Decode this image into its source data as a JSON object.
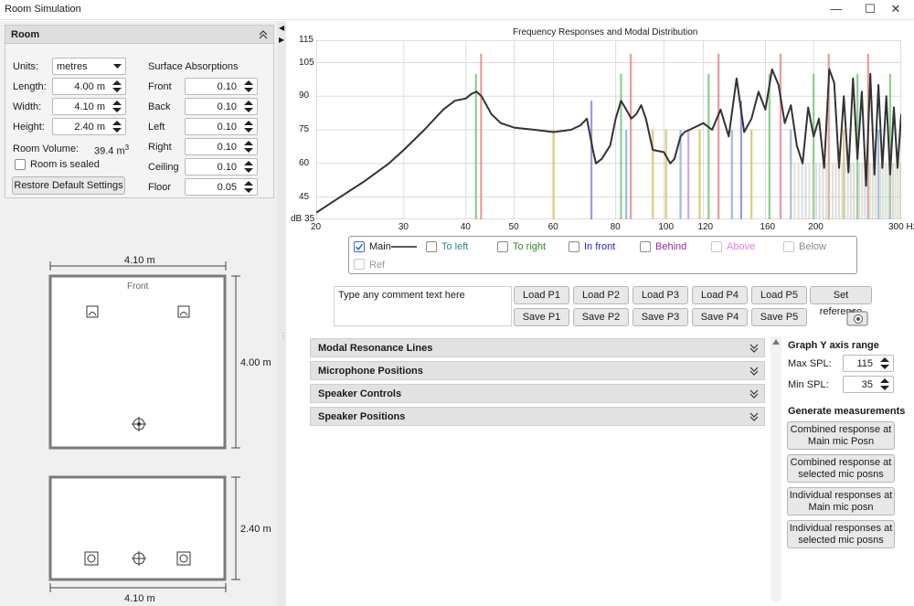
{
  "window": {
    "title": "Room Simulation",
    "minimize": "—",
    "maximize": "☐",
    "close": "✕"
  },
  "room_panel": {
    "header": "Room",
    "collapse_icon": "chevron-double-up",
    "units_label": "Units:",
    "units_value": "metres",
    "length_label": "Length:",
    "length_value": "4.00 m",
    "width_label": "Width:",
    "width_value": "4.10 m",
    "height_label": "Height:",
    "height_value": "2.40 m",
    "volume_label": "Room Volume:",
    "volume_value": "39.4 m",
    "volume_unit_sup": "3",
    "sealed_label": "Room is sealed",
    "sealed_checked": false,
    "restore_button": "Restore Default Settings",
    "absorptions_heading": "Surface Absorptions",
    "absorptions": [
      {
        "label": "Front",
        "value": "0.10"
      },
      {
        "label": "Back",
        "value": "0.10"
      },
      {
        "label": "Left",
        "value": "0.10"
      },
      {
        "label": "Right",
        "value": "0.10"
      },
      {
        "label": "Ceiling",
        "value": "0.10"
      },
      {
        "label": "Floor",
        "value": "0.05"
      }
    ]
  },
  "plan_view": {
    "width_label": "4.10 m",
    "length_label": "4.00 m",
    "front_label": "Front"
  },
  "elevation_view": {
    "height_label": "2.40 m",
    "width_label": "4.10 m"
  },
  "chart_data": {
    "type": "line",
    "title": "Frequency Responses and Modal Distribution",
    "x_scale": "log",
    "xlim": [
      20,
      300
    ],
    "x_ticks": [
      "20",
      "30",
      "40",
      "50",
      "60",
      "80",
      "100",
      "120",
      "160",
      "200",
      "300 Hz"
    ],
    "y_ticks": [
      "dB 35",
      "45",
      "60",
      "75",
      "90",
      "105",
      "115"
    ],
    "ylim": [
      35,
      115
    ],
    "grid": true,
    "series": [
      {
        "name": "Main",
        "color": "#333333",
        "x": [
          20,
          22,
          25,
          28,
          30,
          33,
          36,
          38,
          40,
          41,
          42,
          43,
          44,
          45,
          47,
          50,
          55,
          60,
          65,
          68,
          70,
          72,
          73,
          75,
          78,
          80,
          82,
          84,
          86,
          88,
          90,
          92,
          95,
          100,
          103,
          105,
          108,
          110,
          115,
          120,
          125,
          130,
          135,
          140,
          145,
          150,
          155,
          160,
          165,
          170,
          175,
          180,
          185,
          190,
          195,
          200,
          205,
          210,
          215,
          220,
          225,
          230,
          235,
          240,
          245,
          250,
          255,
          260,
          265,
          270,
          275,
          280,
          285,
          290,
          295,
          300
        ],
        "y": [
          38,
          44,
          52,
          60,
          66,
          75,
          84,
          88,
          89,
          91,
          92,
          90,
          86,
          82,
          78,
          76,
          75,
          74,
          75,
          77,
          80,
          66,
          60,
          62,
          68,
          80,
          88,
          84,
          80,
          82,
          86,
          80,
          66,
          65,
          60,
          62,
          72,
          74,
          76,
          78,
          75,
          84,
          72,
          98,
          74,
          80,
          92,
          84,
          102,
          95,
          78,
          86,
          68,
          60,
          85,
          72,
          80,
          58,
          102,
          96,
          58,
          90,
          56,
          98,
          62,
          92,
          50,
          100,
          55,
          95,
          58,
          90,
          55,
          85,
          58,
          82
        ]
      }
    ],
    "modal_lines": [
      {
        "x": 41.9,
        "y": 100,
        "color": "#7bc67b"
      },
      {
        "x": 42.9,
        "y": 109,
        "color": "#e88a8a"
      },
      {
        "x": 60.0,
        "y": 75,
        "color": "#d9c266"
      },
      {
        "x": 71.5,
        "y": 88,
        "color": "#8a8ae0"
      },
      {
        "x": 82.0,
        "y": 100,
        "color": "#7bc67b"
      },
      {
        "x": 84.0,
        "y": 75,
        "color": "#8ab0e0"
      },
      {
        "x": 85.8,
        "y": 109,
        "color": "#e88a8a"
      },
      {
        "x": 95.0,
        "y": 75,
        "color": "#d9c266"
      },
      {
        "x": 101.0,
        "y": 75,
        "color": "#d9c266"
      },
      {
        "x": 108.0,
        "y": 75,
        "color": "#8ab0e0"
      },
      {
        "x": 112.0,
        "y": 75,
        "color": "#c0a0e0"
      },
      {
        "x": 118.0,
        "y": 75,
        "color": "#d9c266"
      },
      {
        "x": 123.0,
        "y": 100,
        "color": "#7bc67b"
      },
      {
        "x": 128.8,
        "y": 109,
        "color": "#e88a8a"
      },
      {
        "x": 137.0,
        "y": 75,
        "color": "#8ab0e0"
      },
      {
        "x": 143.0,
        "y": 88,
        "color": "#8a8ae0"
      },
      {
        "x": 150.0,
        "y": 75,
        "color": "#d9c266"
      },
      {
        "x": 163.0,
        "y": 100,
        "color": "#7bc67b"
      },
      {
        "x": 171.6,
        "y": 109,
        "color": "#e88a8a"
      },
      {
        "x": 180.0,
        "y": 75,
        "color": "#8ab0e0"
      },
      {
        "x": 200.0,
        "y": 100,
        "color": "#7bc67b"
      },
      {
        "x": 214.5,
        "y": 109,
        "color": "#e88a8a"
      },
      {
        "x": 230.0,
        "y": 75,
        "color": "#d9c266"
      },
      {
        "x": 245.0,
        "y": 100,
        "color": "#7bc67b"
      },
      {
        "x": 257.4,
        "y": 109,
        "color": "#e88a8a"
      },
      {
        "x": 270.0,
        "y": 75,
        "color": "#8ab0e0"
      },
      {
        "x": 285.0,
        "y": 100,
        "color": "#7bc67b"
      }
    ]
  },
  "legend": [
    {
      "label": "Main",
      "checked": true,
      "color": "#222222"
    },
    {
      "label": "To left",
      "checked": false,
      "color": "#2a8a8a"
    },
    {
      "label": "To right",
      "checked": false,
      "color": "#2a8a2a"
    },
    {
      "label": "In front",
      "checked": false,
      "color": "#2a2ac0"
    },
    {
      "label": "Behind",
      "checked": false,
      "color": "#9a2a9a"
    },
    {
      "label": "Above",
      "checked": false,
      "color": "#e080e0"
    },
    {
      "label": "Below",
      "checked": false,
      "color": "#8a8a8a"
    },
    {
      "label": "Ref",
      "checked": false,
      "color": "#9a9a9a"
    }
  ],
  "comment_placeholder": "Type any comment text here",
  "presets": {
    "load": [
      "Load P1",
      "Load P2",
      "Load P3",
      "Load P4",
      "Load P5"
    ],
    "save": [
      "Save P1",
      "Save P2",
      "Save P3",
      "Save P4",
      "Save P5"
    ],
    "set_reference": "Set reference"
  },
  "accordions": [
    "Modal Resonance Lines",
    "Microphone Positions",
    "Speaker Controls",
    "Speaker Positions"
  ],
  "y_axis_panel": {
    "heading": "Graph Y axis range",
    "max_label": "Max SPL:",
    "max_value": "115",
    "min_label": "Min SPL:",
    "min_value": "35"
  },
  "generate": {
    "heading": "Generate measurements",
    "buttons": [
      [
        "Combined response at",
        "Main mic Posn"
      ],
      [
        "Combined response at",
        "selected mic posns"
      ],
      [
        "Individual responses at",
        "Main mic posn"
      ],
      [
        "Individual responses at",
        "selected mic posns"
      ]
    ]
  }
}
